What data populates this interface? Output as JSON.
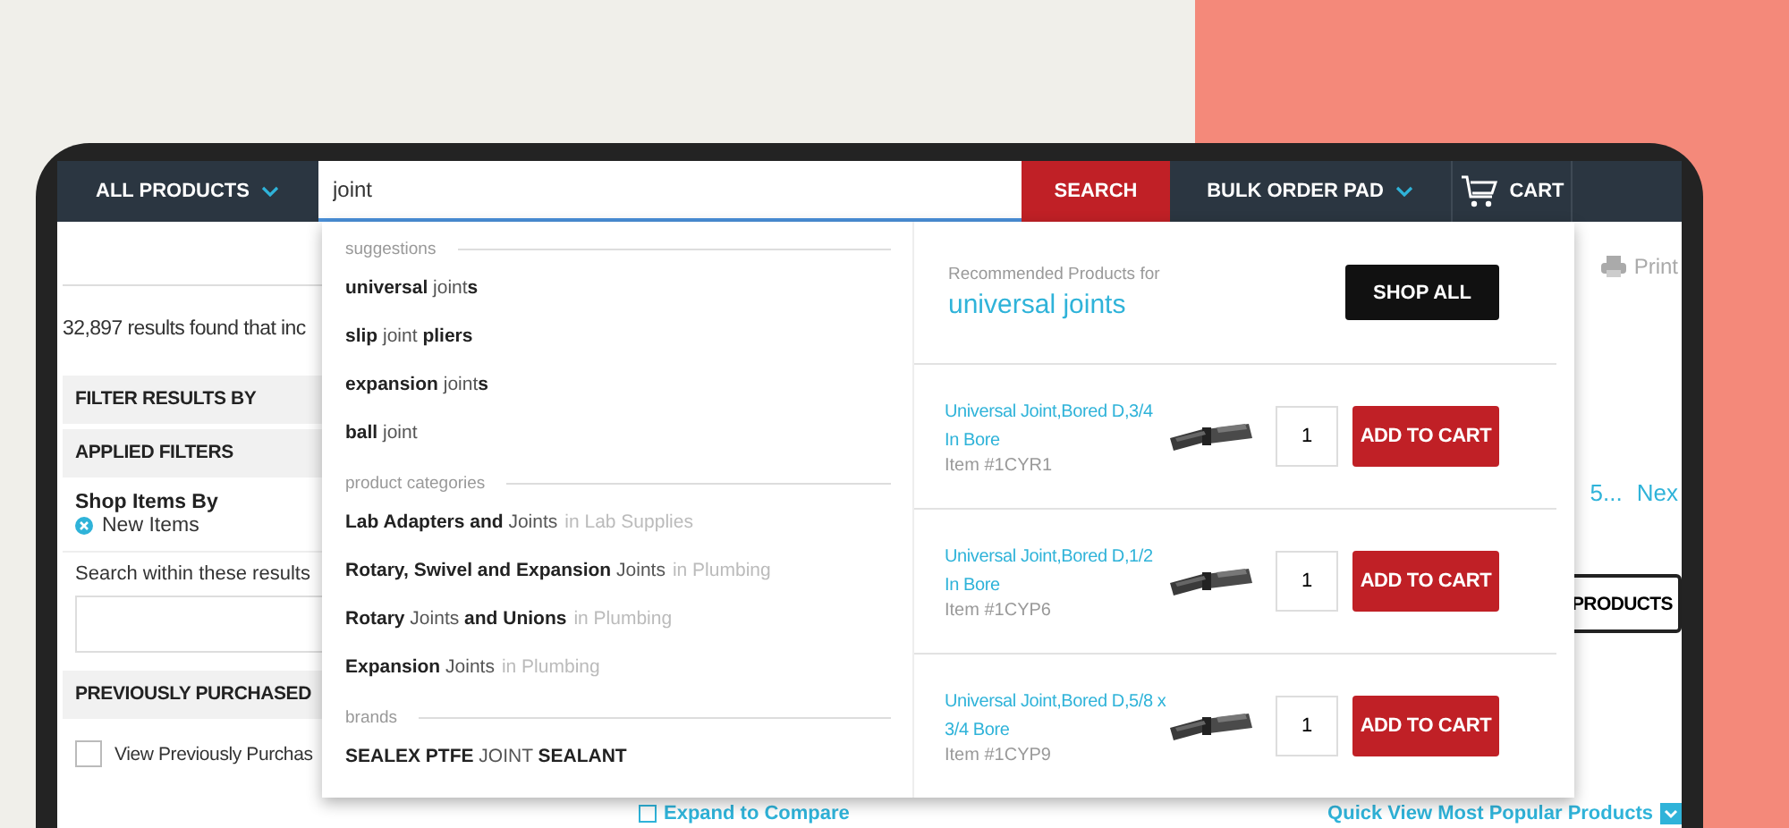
{
  "nav": {
    "all_products": "ALL PRODUCTS",
    "search_value": "joint",
    "search_button": "SEARCH",
    "bulk_order": "BULK ORDER PAD",
    "cart": "CART"
  },
  "sidebar": {
    "results_text": "32,897 results found that inc",
    "filter_heading": "FILTER RESULTS BY",
    "applied_heading": "APPLIED FILTERS",
    "shop_by": "Shop Items By",
    "applied_filter": "New Items",
    "search_within_label": "Search within these results",
    "previously_heading": "PREVIOUSLY PURCHASED",
    "previously_option": {
      "label": "View Previously Purchas",
      "checked": false
    }
  },
  "results": {
    "print": "Print",
    "pages": [
      "5...",
      "Nex"
    ],
    "products_button": "PRODUCTS",
    "expand_compare": "Expand to Compare",
    "quick_view": "Quick View Most Popular Products"
  },
  "dropdown": {
    "groups": [
      {
        "heading": "suggestions",
        "items": [
          {
            "text": "**universal** joint**s**"
          },
          {
            "text": "**slip** joint **pliers**"
          },
          {
            "text": "**expansion** joint**s**"
          },
          {
            "text": "**ball** joint"
          }
        ]
      },
      {
        "heading": "product categories",
        "items": [
          {
            "text": "**Lab Adapters and** Joints",
            "context": "in Lab Supplies"
          },
          {
            "text": "**Rotary, Swivel and Expansion** Joints",
            "context": "in Plumbing"
          },
          {
            "text": "**Rotary** Joints **and Unions**",
            "context": "in Plumbing"
          },
          {
            "text": "**Expansion** Joints",
            "context": "in Plumbing"
          }
        ]
      },
      {
        "heading": "brands",
        "items": [
          {
            "text": "**SEALEX PTFE** JOINT **SEALANT**"
          }
        ]
      }
    ],
    "recommended_label": "Recommended Products for",
    "recommended_term": "universal joints",
    "shop_all": "SHOP ALL",
    "products": [
      {
        "title": "Universal Joint,Bored D,3/4 In Bore",
        "item": "Item #1CYR1",
        "quantity": "1",
        "button": "ADD TO CART"
      },
      {
        "title": "Universal Joint,Bored D,1/2 In Bore",
        "item": "Item #1CYP6",
        "quantity": "1",
        "button": "ADD TO CART"
      },
      {
        "title": "Universal Joint,Bored D,5/8 x 3/4 Bore",
        "item": "Item #1CYP9",
        "quantity": "1",
        "button": "ADD TO CART"
      }
    ]
  }
}
